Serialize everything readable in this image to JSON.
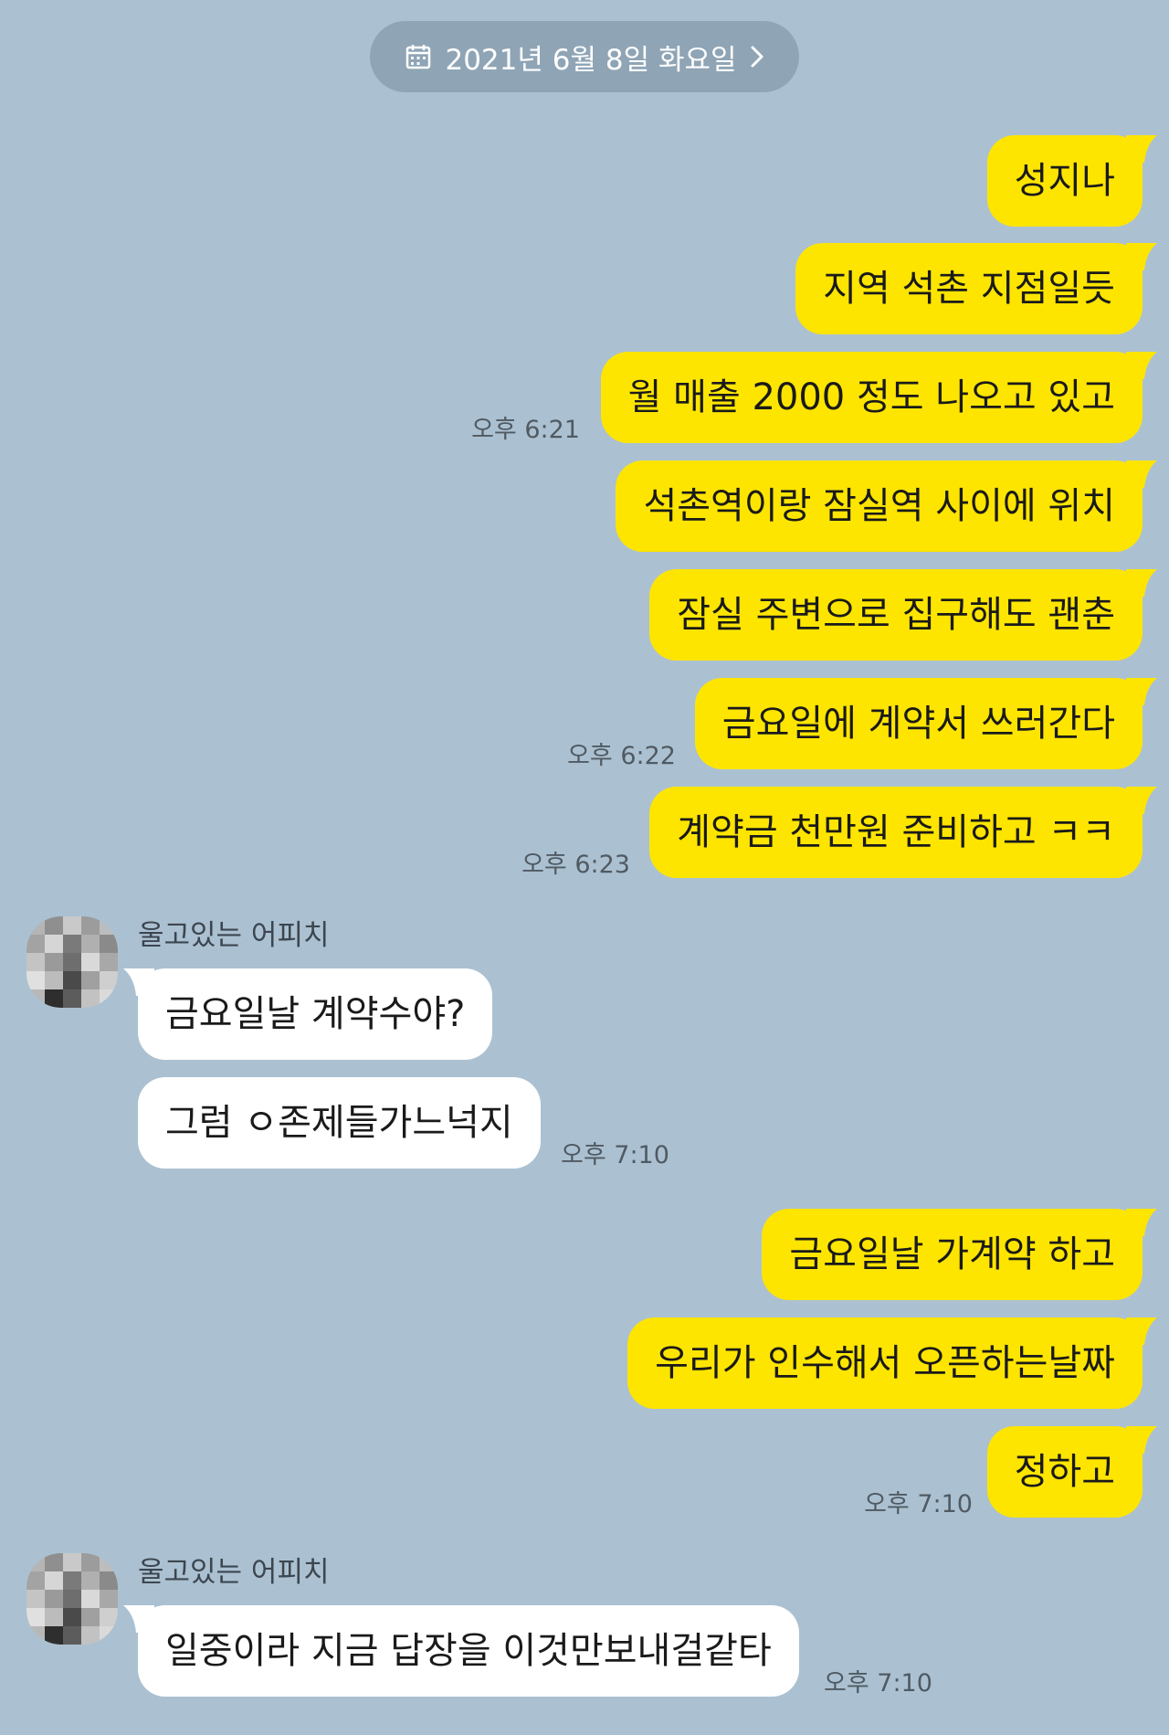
{
  "date_divider": {
    "label": "2021년 6월 8일 화요일",
    "icon": "calendar-icon",
    "chevron": "chevron-right-icon"
  },
  "colors": {
    "background": "#abc1d1",
    "my_bubble": "#fee500",
    "their_bubble": "#ffffff",
    "date_pill": "#8fa5b6"
  },
  "messages": [
    {
      "sender": "me",
      "text": "성지나"
    },
    {
      "sender": "me",
      "text": "지역 석촌 지점일듯"
    },
    {
      "sender": "me",
      "text": "월 매출 2000 정도 나오고 있고",
      "time": "오후 6:21"
    },
    {
      "sender": "me",
      "text": "석촌역이랑 잠실역 사이에 위치"
    },
    {
      "sender": "me",
      "text": "잠실 주변으로 집구해도 괜춘"
    },
    {
      "sender": "me",
      "text": "금요일에 계약서 쓰러간다",
      "time": "오후 6:22"
    },
    {
      "sender": "me",
      "text": "계약금 천만원 준비하고 ㅋㅋ",
      "time": "오후 6:23"
    },
    {
      "sender": "them",
      "name": "울고있는 어피치",
      "text": "금요일날 계약수야?"
    },
    {
      "sender": "them",
      "text": "그럼 ㅇ존제들가느넉지",
      "time": "오후 7:10"
    },
    {
      "sender": "me",
      "text": "금요일날 가계약 하고"
    },
    {
      "sender": "me",
      "text": "우리가 인수해서 오픈하는날짜"
    },
    {
      "sender": "me",
      "text": "정하고",
      "time": "오후 7:10"
    },
    {
      "sender": "them",
      "name": "울고있는 어피치",
      "text": "일중이라 지금 답장을 이것만보내걸같타",
      "time": "오후 7:10"
    }
  ]
}
